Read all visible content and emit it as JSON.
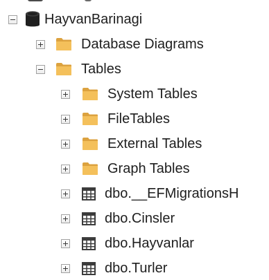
{
  "explorer": {
    "database": {
      "label": "HayvanBarinagi",
      "icon": "database-icon",
      "state": "expanded"
    },
    "nodes": [
      {
        "label": "Database Diagrams",
        "icon": "folder-icon",
        "state": "collapsed"
      },
      {
        "label": "Tables",
        "icon": "folder-icon",
        "state": "expanded"
      },
      {
        "label": "System Tables",
        "icon": "folder-icon",
        "state": "collapsed"
      },
      {
        "label": "FileTables",
        "icon": "folder-icon",
        "state": "collapsed"
      },
      {
        "label": "External Tables",
        "icon": "folder-icon",
        "state": "collapsed"
      },
      {
        "label": "Graph Tables",
        "icon": "folder-icon",
        "state": "collapsed"
      },
      {
        "label": "dbo.__EFMigrationsH",
        "icon": "table-icon",
        "state": "collapsed"
      },
      {
        "label": "dbo.Cinsler",
        "icon": "table-icon",
        "state": "collapsed"
      },
      {
        "label": "dbo.Hayvanlar",
        "icon": "table-icon",
        "state": "collapsed"
      },
      {
        "label": "dbo.Turler",
        "icon": "table-icon",
        "state": "collapsed"
      }
    ]
  },
  "colors": {
    "folder": "#f4c05b",
    "folder_dark": "#dca23f",
    "database": "#1f1f1f",
    "table_grid": "#3c3c3c",
    "text": "#1e1e1e"
  }
}
